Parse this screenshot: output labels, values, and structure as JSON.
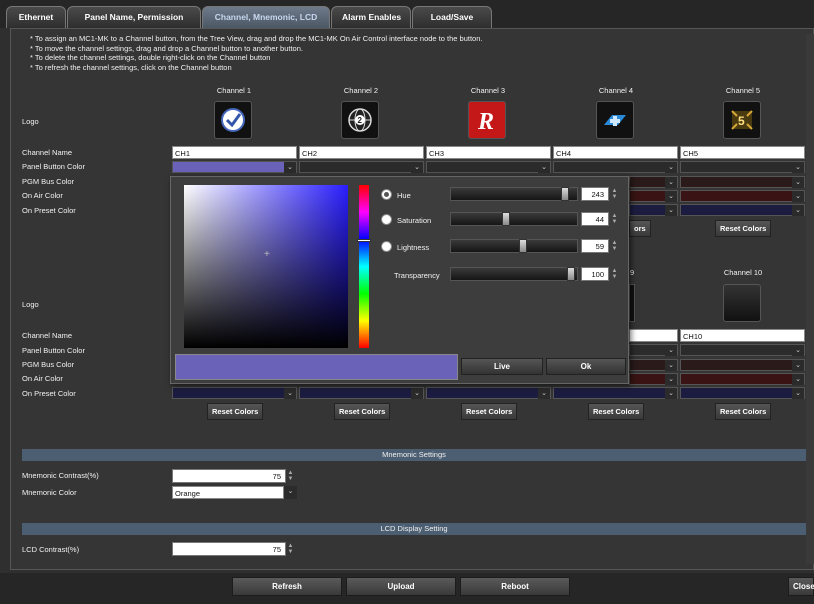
{
  "tabs": [
    {
      "label": "Ethernet"
    },
    {
      "label": "Panel Name, Permission"
    },
    {
      "label": "Channel, Mnemonic, LCD"
    },
    {
      "label": "Alarm Enables"
    },
    {
      "label": "Load/Save"
    }
  ],
  "instructions": [
    "* To assign an MC1-MK to a Channel button, from the Tree View, drag and drop the MC1-MK On Air Control interface node to the button.",
    "* To move the channel settings, drag and drop a Channel button to another button.",
    "* To delete the channel settings, double right-click on the Channel button",
    "* To refresh the channel settings, click on the Channel button"
  ],
  "row_labels": {
    "logo": "Logo",
    "channel_name": "Channel Name",
    "panel_button_color": "Panel Button Color",
    "pgm_bus_color": "PGM Bus Color",
    "on_air_color": "On Air Color",
    "on_preset_color": "On Preset Color"
  },
  "channels_top": [
    {
      "header": "Channel 1",
      "name": "CH1",
      "icon": "checkmark-clock-icon"
    },
    {
      "header": "Channel 2",
      "name": "CH2",
      "icon": "globe-2-icon"
    },
    {
      "header": "Channel 3",
      "name": "CH3",
      "icon": "r-logo-icon"
    },
    {
      "header": "Channel 4",
      "name": "CH4",
      "icon": "plus-blue-icon"
    },
    {
      "header": "Channel 5",
      "name": "CH5",
      "icon": "five-gold-icon"
    }
  ],
  "channels_bottom": [
    {
      "header": "9",
      "name": ""
    },
    {
      "header": "Channel 10",
      "name": "CH10"
    }
  ],
  "reset_label": "Reset Colors",
  "reset_partial": "ors",
  "mnemonic": {
    "section": "Mnemonic Settings",
    "contrast_label": "Mnemonic Contrast(%)",
    "contrast_value": "75",
    "color_label": "Mnemonic Color",
    "color_value": "Orange"
  },
  "lcd": {
    "section": "LCD Display Setting",
    "contrast_label": "LCD Contrast(%)",
    "contrast_value": "75"
  },
  "picker": {
    "hue_label": "Hue",
    "hue_value": "243",
    "hue_fraction": 0.952,
    "saturation_label": "Saturation",
    "saturation_value": "44",
    "saturation_fraction": 0.44,
    "lightness_label": "Lightness",
    "lightness_value": "59",
    "lightness_fraction": 0.59,
    "transparency_label": "Transparency",
    "transparency_value": "100",
    "transparency_fraction": 1.0,
    "live_label": "Live",
    "ok_label": "Ok",
    "preview_color": "#6a62b8"
  },
  "bottom": {
    "refresh": "Refresh",
    "upload": "Upload",
    "reboot": "Reboot",
    "close": "Close"
  },
  "colors": {
    "panel_button": "#6a62b8",
    "pgm_bus": "#2a1a1a",
    "on_air": "#3a1414",
    "on_preset": "#1c1c40",
    "section": "#4c5e72"
  }
}
